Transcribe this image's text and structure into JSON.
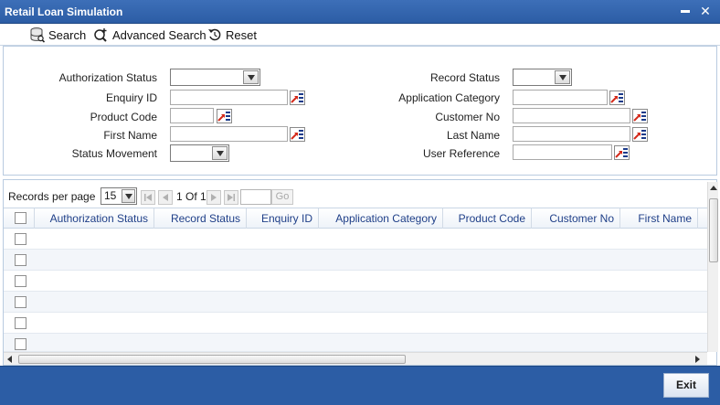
{
  "window": {
    "title": "Retail Loan Simulation",
    "minimize_glyph": "▬",
    "close_glyph": "✕"
  },
  "toolbar": {
    "search_label": "Search",
    "advanced_search_label": "Advanced Search",
    "reset_label": "Reset"
  },
  "criteria": {
    "authorization_status_label": "Authorization Status",
    "enquiry_id_label": "Enquiry ID",
    "product_code_label": "Product Code",
    "first_name_label": "First Name",
    "status_movement_label": "Status Movement",
    "record_status_label": "Record Status",
    "application_category_label": "Application Category",
    "customer_no_label": "Customer No",
    "last_name_label": "Last Name",
    "user_reference_label": "User Reference"
  },
  "pager": {
    "records_per_page_label": "Records per page",
    "records_per_page_value": "15",
    "page_text": "1 Of 1",
    "go_label": "Go"
  },
  "grid": {
    "columns": [
      "Authorization Status",
      "Record Status",
      "Enquiry ID",
      "Application Category",
      "Product Code",
      "Customer No",
      "First Name"
    ]
  },
  "footer": {
    "exit_label": "Exit"
  },
  "colors": {
    "titlebar": "#2c5da5",
    "header_text": "#1f3f88",
    "lov_red": "#d42a1a",
    "lov_blue": "#1b3a8a"
  },
  "icons": [
    "search-icon",
    "advanced-search-icon",
    "reset-icon",
    "lov-icon",
    "first-page-icon",
    "prev-page-icon",
    "next-page-icon",
    "last-page-icon"
  ]
}
